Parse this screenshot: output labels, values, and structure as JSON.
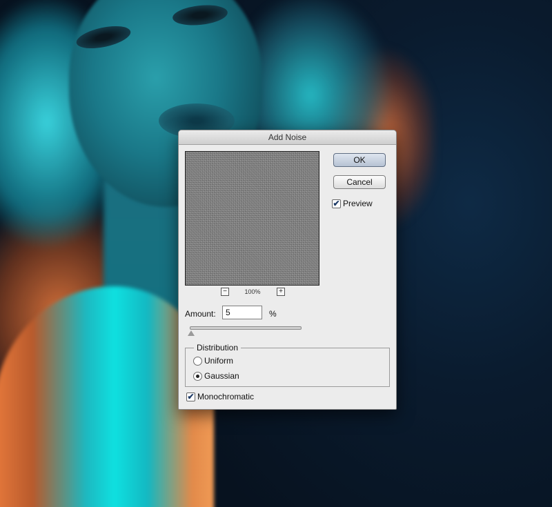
{
  "dialog": {
    "title": "Add Noise",
    "ok_label": "OK",
    "cancel_label": "Cancel",
    "preview_label": "Preview",
    "preview_checked": true,
    "zoom_level": "100%",
    "zoom_out_symbol": "−",
    "zoom_in_symbol": "+",
    "amount_label": "Amount:",
    "amount_value": "5",
    "amount_unit": "%",
    "amount_slider_fraction": 0.0125,
    "distribution": {
      "title": "Distribution",
      "options": [
        "Uniform",
        "Gaussian"
      ],
      "selected": "Gaussian"
    },
    "monochromatic_label": "Monochromatic",
    "monochromatic_checked": true,
    "check_mark": "✔"
  },
  "colors": {
    "ok_button_tint": "#b6c2d3",
    "background_teal": "#1db8c0",
    "background_orange": "#e87a3c",
    "background_dark": "#0b1a2b"
  },
  "icons": {
    "preview_checkbox": "check-icon",
    "monochromatic_checkbox": "check-icon",
    "zoom_out": "minus-icon",
    "zoom_in": "plus-icon"
  }
}
